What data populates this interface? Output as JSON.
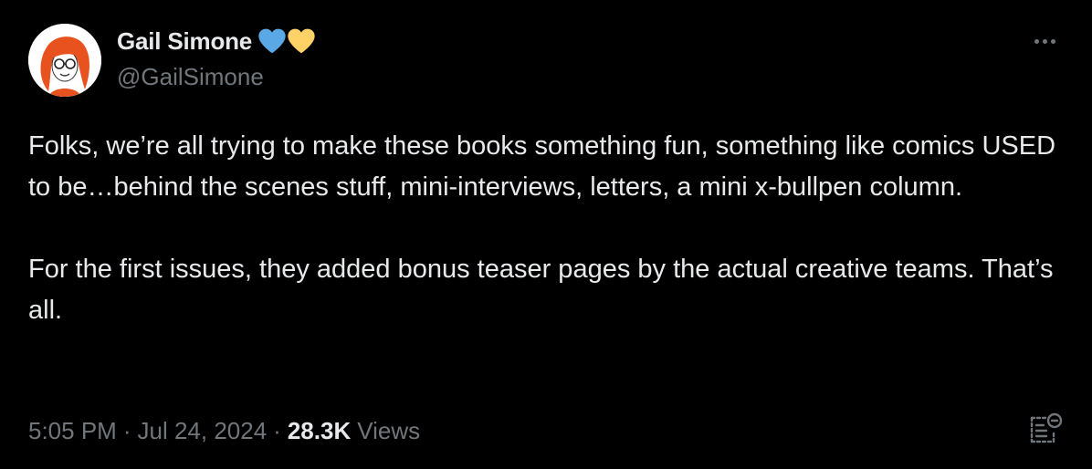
{
  "author": {
    "display_name": "Gail Simone",
    "handle": "@GailSimone",
    "badges": [
      "blue-heart-icon",
      "yellow-heart-icon"
    ],
    "avatar_icon": "avatar-illustration"
  },
  "tweet": {
    "paragraphs": [
      "Folks, we’re all trying to make these books something fun, something like comics USED to be…behind the scenes stuff, mini-interviews, letters, a mini x-bullpen column.",
      "For the first issues, they added bonus teaser pages by the actual creative teams. That’s all."
    ]
  },
  "meta": {
    "time": "5:05 PM",
    "separator": "·",
    "date": "Jul 24, 2024",
    "views_count": "28.3K",
    "views_label": "Views"
  },
  "colors": {
    "background": "#000000",
    "primary_text": "#e7e9ea",
    "secondary_text": "#71767b",
    "blue_heart": "#5aa9e6",
    "yellow_heart": "#ffd268"
  },
  "icons": {
    "more": "more-icon",
    "notes": "notes-icon"
  }
}
